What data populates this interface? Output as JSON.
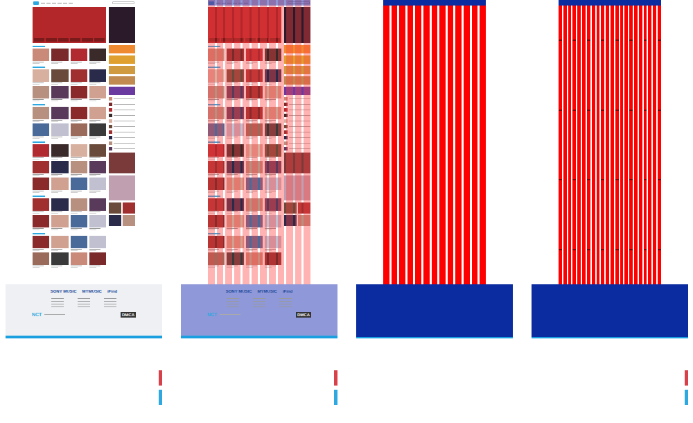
{
  "panels": [
    {
      "kind": "screenshot"
    },
    {
      "kind": "overlay"
    },
    {
      "kind": "mask"
    },
    {
      "kind": "mask-dense"
    }
  ],
  "footer": {
    "brand": "NCT",
    "partners": [
      "SONY MUSIC",
      "MYMUSIC",
      "iFind"
    ],
    "badge": "DMCA"
  }
}
